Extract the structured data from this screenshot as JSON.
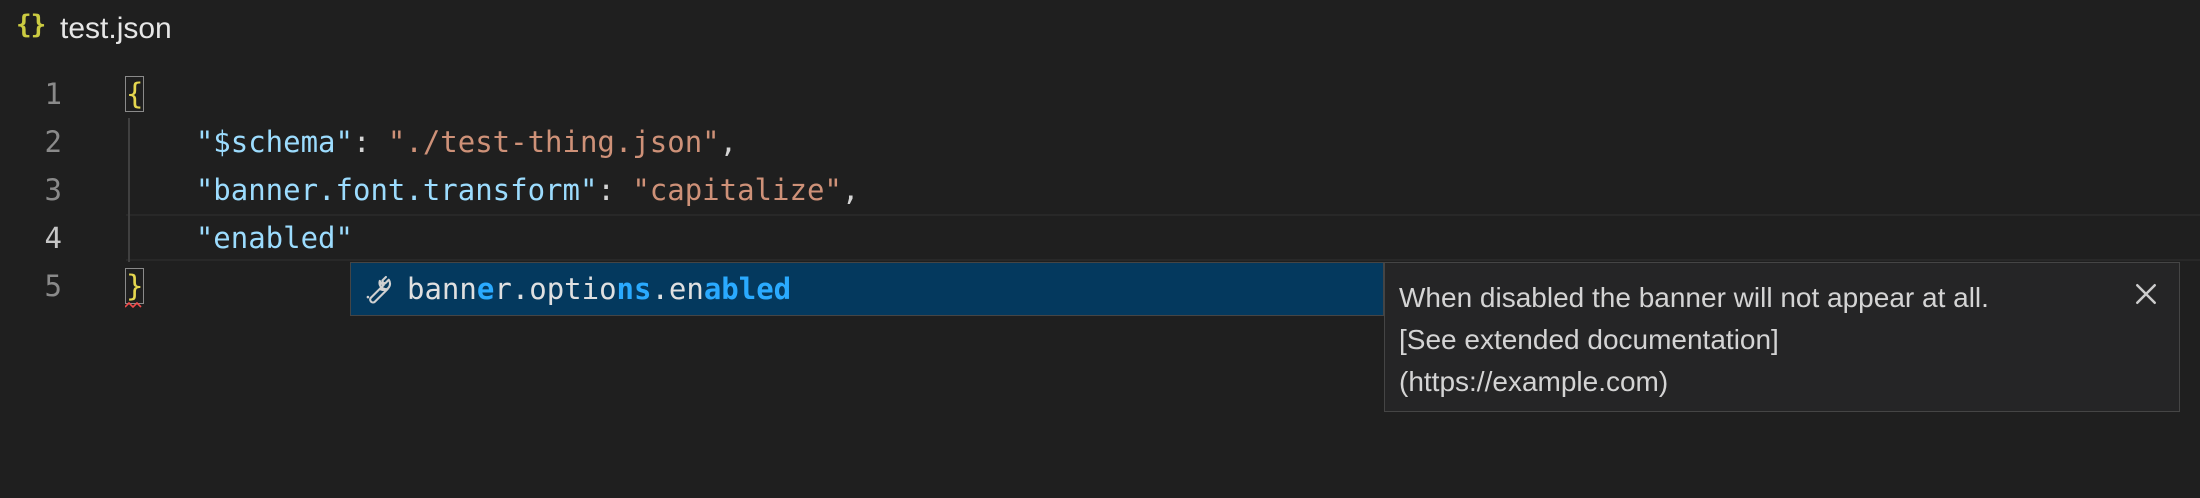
{
  "tab": {
    "icon": "json-braces-icon",
    "icon_text": "{}",
    "title": "test.json"
  },
  "editor": {
    "line_numbers": [
      "1",
      "2",
      "3",
      "4",
      "5"
    ],
    "lines": {
      "l1": {
        "open_brace": "{"
      },
      "l2": {
        "key": "\"$schema\"",
        "sep": ": ",
        "value": "\"./test-thing.json\"",
        "comma": ","
      },
      "l3": {
        "key": "\"banner.font.transform\"",
        "sep": ": ",
        "value": "\"capitalize\"",
        "comma": ","
      },
      "l4": {
        "key": "\"enabled\""
      },
      "l5": {
        "close_brace": "}"
      }
    }
  },
  "suggest": {
    "icon": "wrench-icon",
    "label_parts": [
      "bann",
      "e",
      "r.optio",
      "ns",
      ".en",
      "abled"
    ],
    "highlight_color": "#2aaaff",
    "selected_bg": "#04395e"
  },
  "details": {
    "lines": [
      "When disabled the banner will not appear at all.",
      "[See extended documentation]",
      "(https://example.com)"
    ],
    "close_icon": "close-icon"
  },
  "colors": {
    "background": "#1f1f1f",
    "key": "#9cdcfe",
    "string": "#ce9178",
    "json_icon": "#cbcb41"
  }
}
